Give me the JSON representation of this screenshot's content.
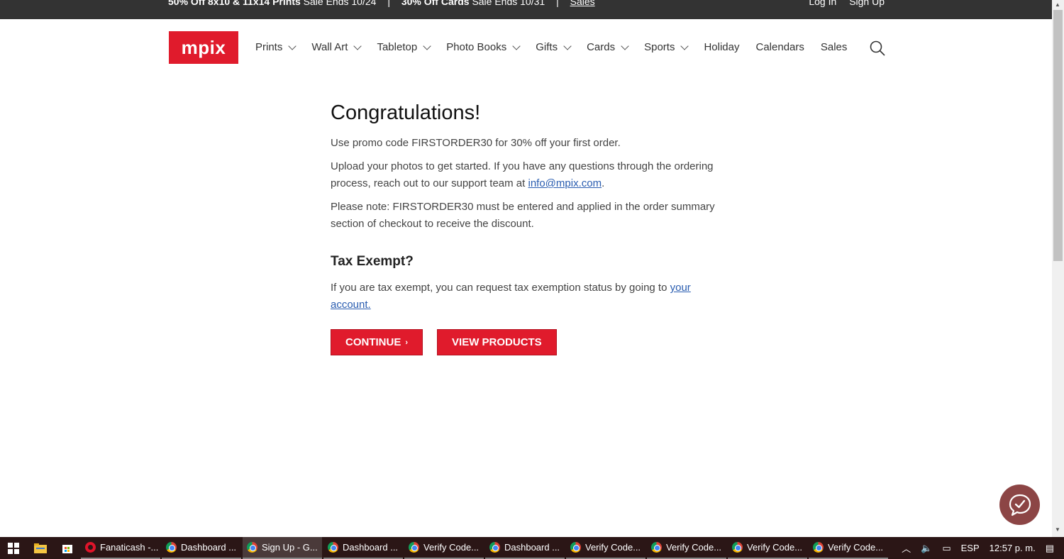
{
  "promo_bar": {
    "offer1_bold": "50% Off 8x10 & 11x14 Prints",
    "offer1_rest": "Sale Ends 10/24",
    "separator": "|",
    "offer2_bold": "30% Off Cards",
    "offer2_rest": "Sale Ends 10/31",
    "sales_link": "Sales",
    "login": "Log In",
    "signup": "Sign Up"
  },
  "header": {
    "logo": "mpix",
    "nav": [
      {
        "label": "Prints"
      },
      {
        "label": "Wall Art"
      },
      {
        "label": "Tabletop"
      },
      {
        "label": "Photo Books"
      },
      {
        "label": "Gifts"
      },
      {
        "label": "Cards"
      },
      {
        "label": "Sports"
      },
      {
        "label": "Holiday"
      },
      {
        "label": "Calendars"
      },
      {
        "label": "Sales"
      }
    ]
  },
  "main": {
    "title": "Congratulations!",
    "p1": "Use promo code FIRSTORDER30 for 30% off your first order.",
    "p2_before": "Upload your photos to get started. If you have any questions through the ordering process, reach out to our support team at ",
    "p2_link": "info@mpix.com",
    "p2_after": ".",
    "p3": "Please note: FIRSTORDER30 must be entered and applied in the order summary section of checkout to receive the discount.",
    "tax_title": "Tax Exempt?",
    "tax_before": "If you are tax exempt, you can request tax exemption status by going to ",
    "tax_link": "your account.",
    "continue_label": "CONTINUE",
    "continue_arrow": "›",
    "view_products_label": "VIEW PRODUCTS"
  },
  "taskbar": {
    "tasks": [
      {
        "label": "Fanaticash -...",
        "icon": "opera-icon"
      },
      {
        "label": "Dashboard ...",
        "icon": "chrome-icon"
      },
      {
        "label": "Sign Up - G...",
        "icon": "chrome-icon"
      },
      {
        "label": "Dashboard ...",
        "icon": "chrome-icon"
      },
      {
        "label": "Verify Code...",
        "icon": "chrome-icon"
      },
      {
        "label": "Dashboard ...",
        "icon": "chrome-icon"
      },
      {
        "label": "Verify Code...",
        "icon": "chrome-icon"
      },
      {
        "label": "Verify Code...",
        "icon": "chrome-icon"
      },
      {
        "label": "Verify Code...",
        "icon": "chrome-icon"
      },
      {
        "label": "Verify Code...",
        "icon": "chrome-icon"
      }
    ],
    "lang": "ESP",
    "time": "12:57 p. m."
  },
  "colors": {
    "brand_red": "#e01b2c",
    "link_blue": "#2a5db0",
    "chat_bubble": "#8c4545"
  }
}
